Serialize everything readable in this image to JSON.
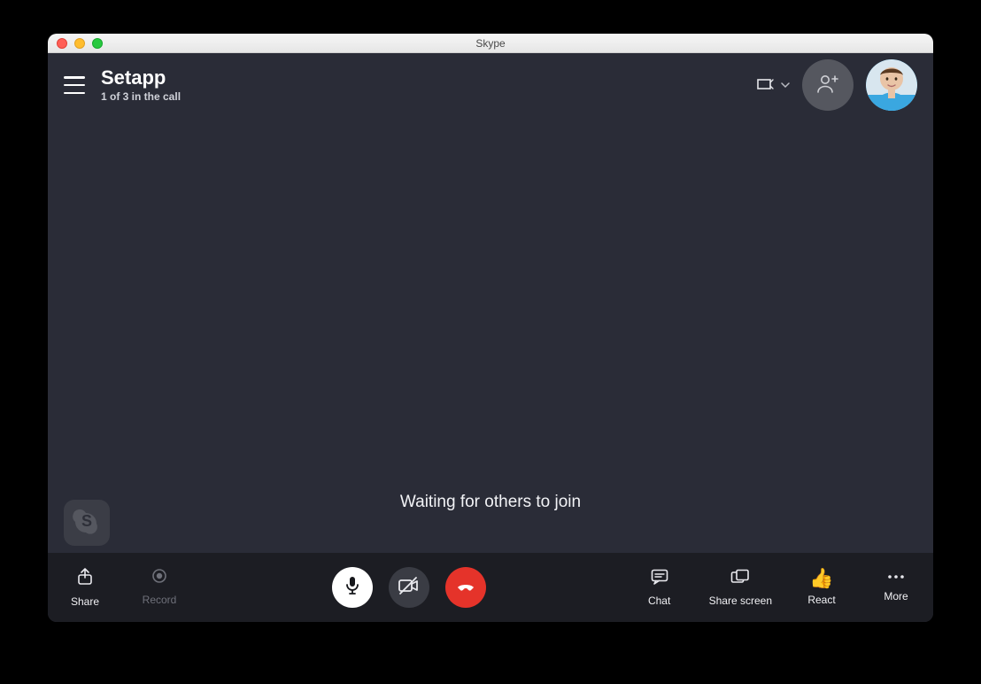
{
  "window": {
    "title": "Skype"
  },
  "header": {
    "call_title": "Setapp",
    "call_status": "1 of 3 in the call"
  },
  "main": {
    "waiting_text": "Waiting for others to join"
  },
  "footer": {
    "share": "Share",
    "record": "Record",
    "chat": "Chat",
    "share_screen": "Share screen",
    "react": "React",
    "more": "More"
  }
}
